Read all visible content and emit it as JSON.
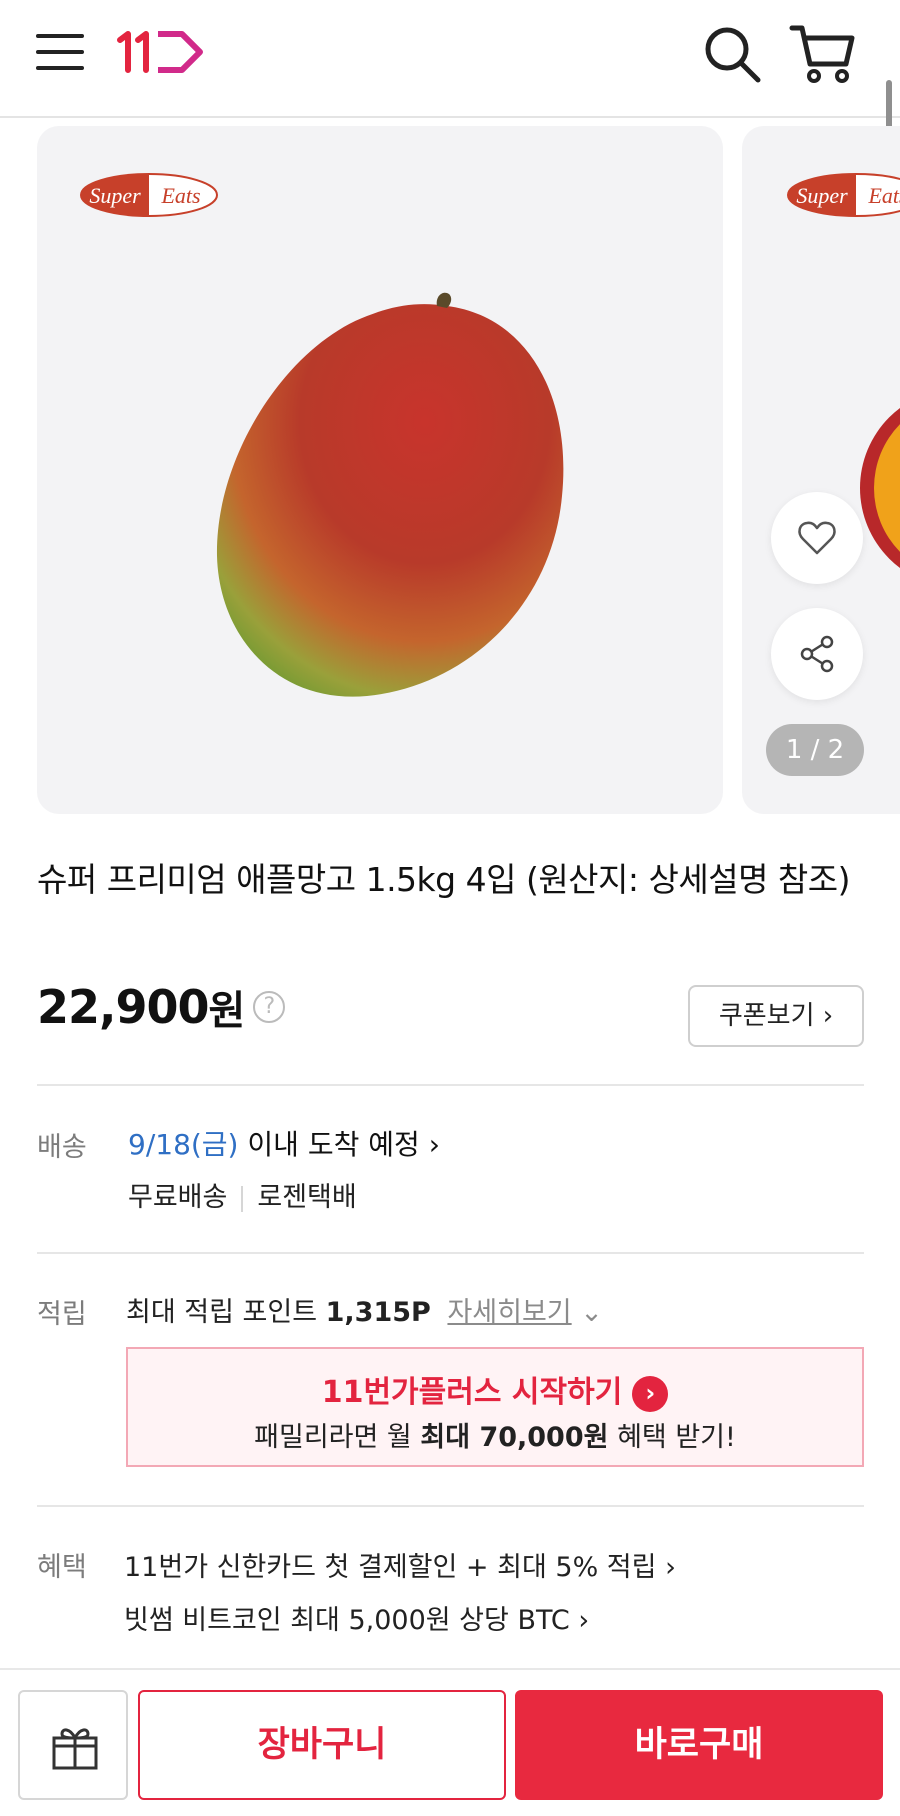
{
  "header": {
    "menu_icon": "hamburger-menu-icon",
    "logo_text": "11",
    "search_icon": "search-icon",
    "cart_icon": "shopping-cart-icon",
    "brand_color": "#e3243f"
  },
  "gallery": {
    "brand_badge_text_1": "Super",
    "brand_badge_text_2": "Eats",
    "page_indicator": "1 / 2",
    "like_icon": "heart-icon",
    "share_icon": "share-icon"
  },
  "product": {
    "title": "슈퍼 프리미엄 애플망고 1.5kg 4입 (원산지: 상세설명 참조)",
    "price": "22,900",
    "price_unit": "원",
    "price_help": "?",
    "coupon_button": "쿠폰보기"
  },
  "delivery": {
    "label": "배송",
    "date": "9/18(금)",
    "arrival_text": "이내 도착 예정",
    "shipping_fee": "무료배송",
    "carrier": "로젠택배"
  },
  "points": {
    "label": "적립",
    "max_points_label": "최대 적립 포인트",
    "max_points_value": "1,315P",
    "details_link": "자세히보기",
    "promo_title": "11번가플러스 시작하기",
    "promo_sub_prefix": "패밀리라면 월",
    "promo_sub_highlight": "최대 70,000원",
    "promo_sub_suffix": "혜택 받기!"
  },
  "benefits": {
    "label": "혜택",
    "items": [
      "11번가 신한카드 첫 결제할인 + 최대 5% 적립",
      "빗썸 비트코인 최대 5,000원 상당 BTC"
    ]
  },
  "bottom_bar": {
    "gift_icon": "gift-icon",
    "add_to_cart": "장바구니",
    "buy_now": "바로구매"
  }
}
